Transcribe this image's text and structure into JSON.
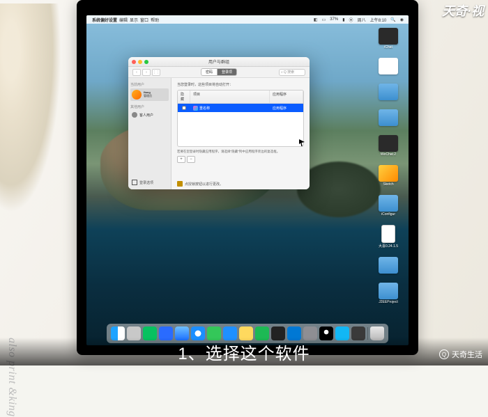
{
  "overlay": {
    "top_right_brand": "天奇·视",
    "subtitle": "1、选择这个软件",
    "watermark": "天奇生活"
  },
  "decor": {
    "side_text": "also print &king"
  },
  "menubar": {
    "app": "系统偏好设置",
    "items": [
      "编辑",
      "显示",
      "窗口",
      "帮助"
    ],
    "right": {
      "battery": "37%",
      "day": "周八",
      "time": "上午8:10"
    }
  },
  "desktop": {
    "icons": [
      {
        "label": "iChat"
      },
      {
        "label": ""
      },
      {
        "label": ""
      },
      {
        "label": ""
      },
      {
        "label": "WeChat 2"
      },
      {
        "label": "Sketch"
      },
      {
        "label": "iConfigur"
      },
      {
        "label": "大喜0.24.1.5"
      },
      {
        "label": ""
      },
      {
        "label": "J2EEProject"
      }
    ]
  },
  "window": {
    "title": "用户与群组",
    "segmented": {
      "left": "密码",
      "right": "登录项"
    },
    "search_placeholder": "Q 搜索",
    "sidebar": {
      "group_current": "当前用户",
      "user": {
        "name": "ftang",
        "role": "管理员"
      },
      "group_other": "其他用户",
      "guest": "客人用户",
      "login_options": "登录选项"
    },
    "content": {
      "hint": "当您登录时，这些项目将自动打开：",
      "columns": {
        "hide": "隐藏",
        "item": "项目",
        "kind": "应用程序"
      },
      "rows": [
        {
          "name": "重名称",
          "kind": "应用程序",
          "hidden": false,
          "selected": true
        }
      ],
      "footer_hint": "若要在您登录时隐藏应用程序，请选择\"隐藏\"列中应用程序旁边的复选框。",
      "lock_hint": "点授锁按钮以进行更改。"
    }
  },
  "dock": {
    "items": [
      "finder",
      "launchpad",
      "wechat",
      "qq-browser",
      "qq-mail",
      "safari",
      "messages",
      "appstore",
      "notes",
      "spotify",
      "terminal",
      "vscode",
      "settings",
      "qq",
      "typora",
      "music",
      "trash"
    ]
  },
  "colors": {
    "selection": "#0a5cff",
    "accent_orange": "#ff8800"
  }
}
